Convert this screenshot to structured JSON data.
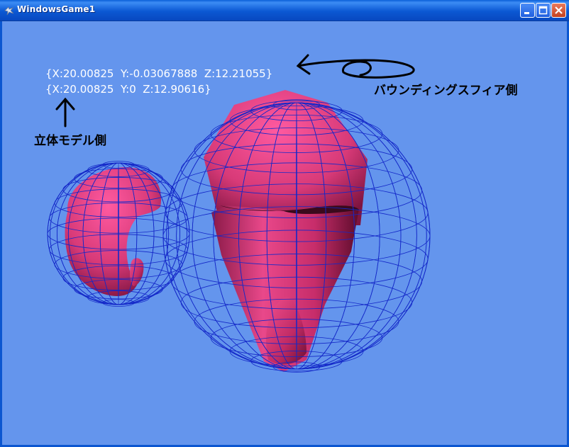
{
  "window": {
    "title": "WindowsGame1",
    "background_color": "#6495ED",
    "controls": {
      "minimize_icon": "minimize-icon",
      "maximize_icon": "maximize-icon",
      "close_icon": "close-icon"
    }
  },
  "hud": {
    "bounding_line": "{X:20.00825  Y:-0.03067888  Z:12.21055}",
    "model_line": "{X:20.00825  Y:0  Z:12.90616}"
  },
  "annotations": {
    "bounding_sphere_label": "バウンディングスフィア側",
    "model_label": "立体モデル側"
  },
  "scene": {
    "model_color": "#E0407A",
    "wireframe_color": "#1428C8"
  }
}
